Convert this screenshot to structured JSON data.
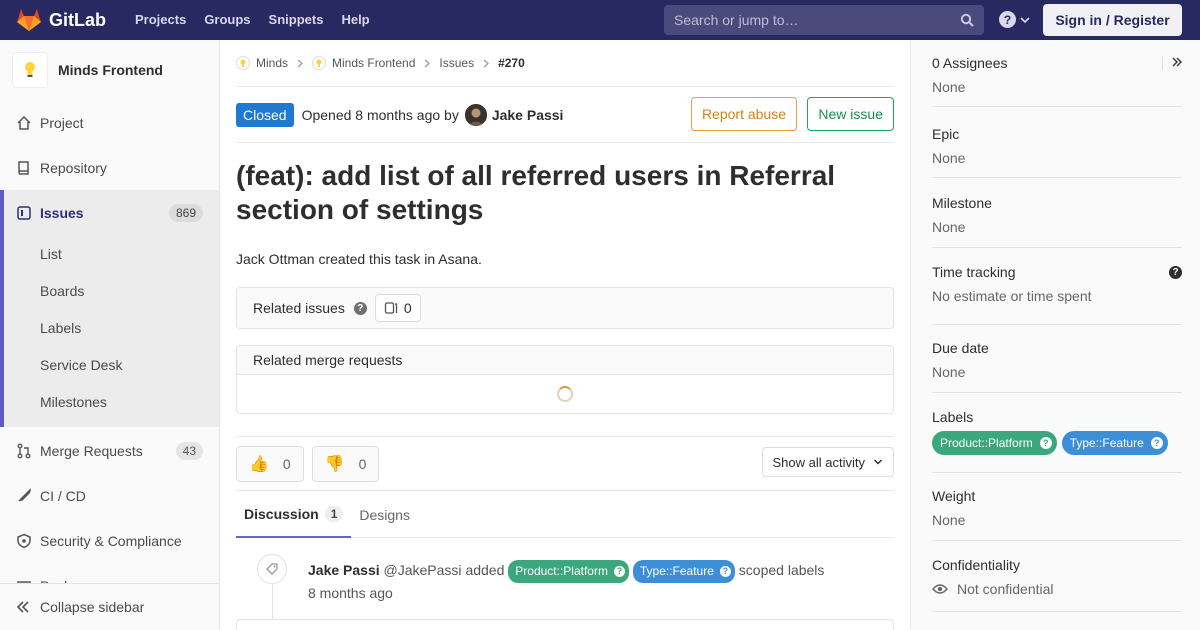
{
  "navbar": {
    "brand": "GitLab",
    "links": [
      "Projects",
      "Groups",
      "Snippets",
      "Help"
    ],
    "search_placeholder": "Search or jump to…",
    "signin_label": "Sign in / Register"
  },
  "sidebar": {
    "project_name": "Minds Frontend",
    "items": {
      "project": "Project",
      "repository": "Repository",
      "issues": "Issues",
      "issues_count": "869",
      "merge_requests": "Merge Requests",
      "merge_requests_count": "43",
      "ci_cd": "CI / CD",
      "security": "Security & Compliance",
      "partial": "Packages"
    },
    "sub_items": [
      "List",
      "Boards",
      "Labels",
      "Service Desk",
      "Milestones"
    ],
    "collapse_label": "Collapse sidebar"
  },
  "breadcrumb": [
    "Minds",
    "Minds Frontend",
    "Issues",
    "#270"
  ],
  "issue": {
    "status": "Closed",
    "opened_text": "Opened 8 months ago by",
    "author": "Jake Passi",
    "report_abuse": "Report abuse",
    "new_issue": "New issue",
    "title": "(feat): add list of all referred users in Referral section of settings",
    "description": "Jack Ottman created this task in Asana."
  },
  "related_issues": {
    "label": "Related issues",
    "count": "0"
  },
  "related_mrs": {
    "label": "Related merge requests"
  },
  "reactions": {
    "thumbs_up_count": "0",
    "thumbs_down_count": "0",
    "show_activity": "Show all activity"
  },
  "tabs": {
    "discussion": "Discussion",
    "discussion_count": "1",
    "designs": "Designs"
  },
  "note": {
    "author": "Jake Passi",
    "handle": "@JakePassi",
    "action": "added",
    "label1": "Product::Platform",
    "label2": "Type::Feature",
    "suffix": "scoped labels",
    "time": "8 months ago"
  },
  "right_sidebar": {
    "assignees_title": "0 Assignees",
    "assignees_value": "None",
    "epic_title": "Epic",
    "epic_value": "None",
    "milestone_title": "Milestone",
    "milestone_value": "None",
    "time_tracking_title": "Time tracking",
    "time_tracking_value": "No estimate or time spent",
    "due_date_title": "Due date",
    "due_date_value": "None",
    "labels_title": "Labels",
    "labels": [
      "Product::Platform",
      "Type::Feature"
    ],
    "weight_title": "Weight",
    "weight_value": "None",
    "confidentiality_title": "Confidentiality",
    "confidentiality_value": "Not confidential"
  },
  "colors": {
    "navbar": "#292961",
    "closed_badge": "#1f78d1",
    "label_platform": "#3aa77f",
    "label_feature": "#3c8fd6",
    "report_abuse": "#e5a33c",
    "new_issue": "#1aaa55"
  }
}
